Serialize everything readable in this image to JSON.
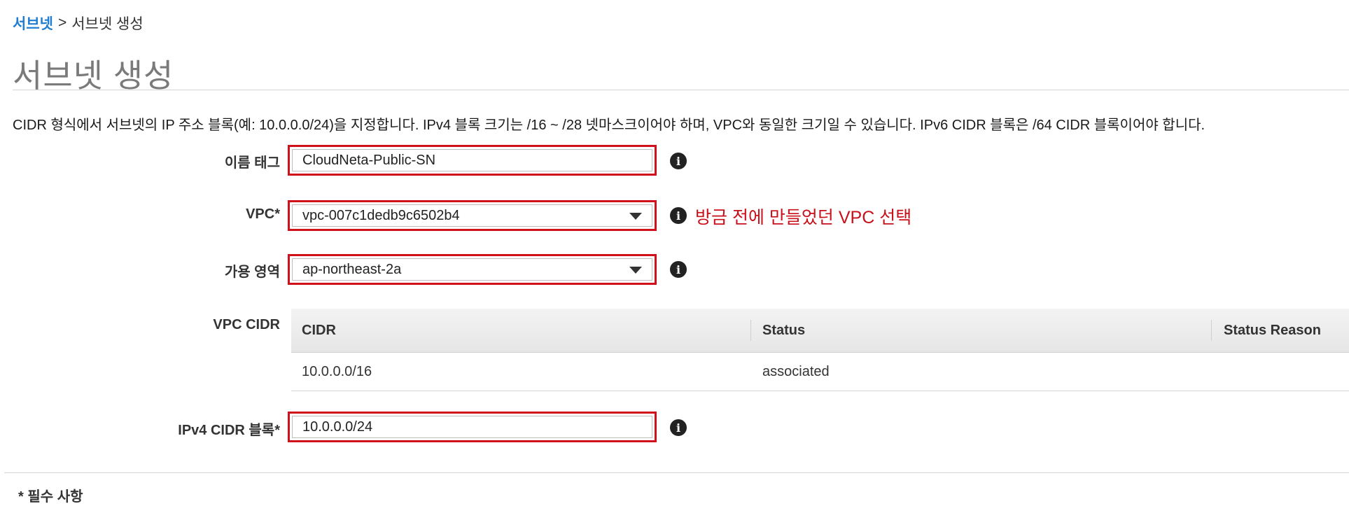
{
  "breadcrumb": {
    "parent": "서브넷",
    "separator": ">",
    "current": "서브넷 생성"
  },
  "page_title": "서브넷 생성",
  "description": "CIDR 형식에서 서브넷의 IP 주소 블록(예: 10.0.0.0/24)을 지정합니다. IPv4 블록 크기는 /16 ~ /28 넷마스크이어야 하며, VPC와 동일한 크기일 수 있습니다. IPv6 CIDR 블록은 /64 CIDR 블록이어야 합니다.",
  "form": {
    "name_tag": {
      "label": "이름 태그",
      "value": "CloudNeta-Public-SN"
    },
    "vpc": {
      "label": "VPC*",
      "value": "vpc-007c1dedb9c6502b4",
      "annotation": "방금 전에 만들었던 VPC 선택"
    },
    "availability_zone": {
      "label": "가용 영역",
      "value": "ap-northeast-2a"
    },
    "vpc_cidr": {
      "label": "VPC CIDR",
      "columns": [
        "CIDR",
        "Status",
        "Status Reason"
      ],
      "rows": [
        {
          "cidr": "10.0.0.0/16",
          "status": "associated",
          "reason": ""
        }
      ]
    },
    "ipv4_cidr": {
      "label": "IPv4 CIDR 블록*",
      "value": "10.0.0.0/24"
    }
  },
  "info_icon_glyph": "i",
  "required_note": "* 필수 사항",
  "colors": {
    "link": "#1f7ed0",
    "highlight_border": "#d0111b",
    "annotation": "#c8101a",
    "status_ok": "#1d8f2b"
  }
}
